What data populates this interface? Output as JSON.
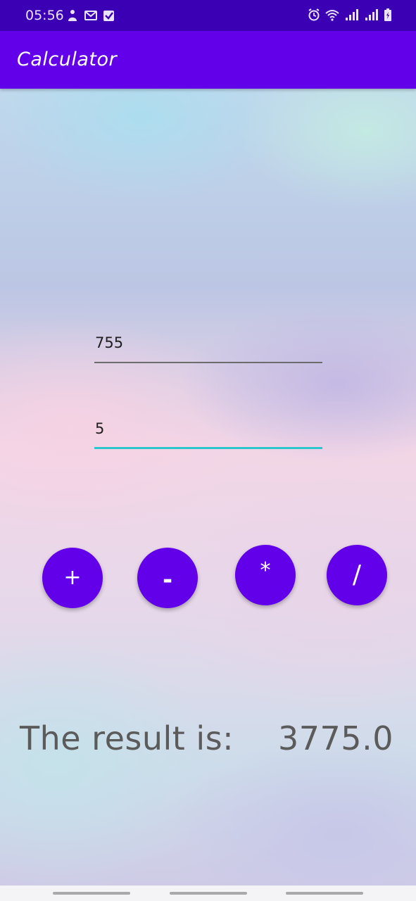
{
  "status_bar": {
    "time": "05:56",
    "left_icons": [
      "notification-person-icon",
      "gmail-icon",
      "check-box-icon"
    ],
    "right_icons": [
      "alarm-icon",
      "wifi-icon",
      "signal-icon",
      "signal-icon",
      "battery-charging-icon"
    ]
  },
  "app_bar": {
    "title": "Calculator"
  },
  "inputs": {
    "first_number": "755",
    "second_number": "5"
  },
  "operations": {
    "add_label": "+",
    "subtract_label": "-",
    "multiply_label": "*",
    "divide_label": "/"
  },
  "result": {
    "label": "The result is:",
    "value": "3775.0"
  },
  "colors": {
    "accent": "#6200ea",
    "status_bar": "#3b00b4",
    "focused_underline": "#2cc6cc"
  }
}
